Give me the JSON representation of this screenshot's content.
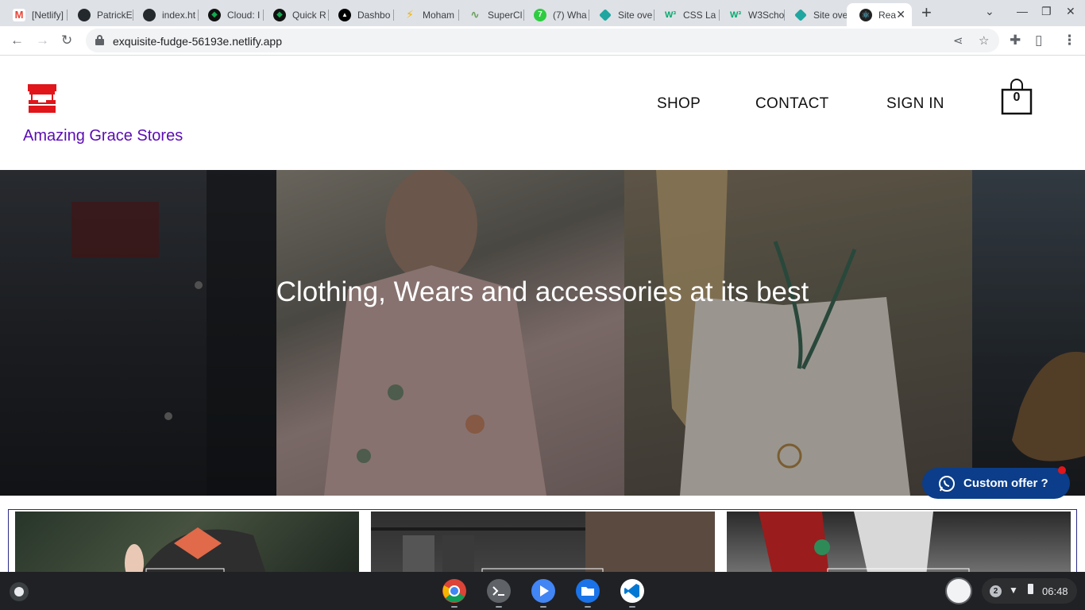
{
  "browser": {
    "tabs": [
      {
        "label": "[Netlify]",
        "icon": "gmail-icon",
        "color": "#ea4335"
      },
      {
        "label": "PatrickE",
        "icon": "github-icon",
        "color": "#24292e"
      },
      {
        "label": "index.ht",
        "icon": "github-icon",
        "color": "#24292e"
      },
      {
        "label": "Cloud: I",
        "icon": "mongodb-leaf-icon",
        "color": "#13aa52"
      },
      {
        "label": "Quick R",
        "icon": "mongodb-leaf-icon",
        "color": "#13aa52"
      },
      {
        "label": "Dashbo",
        "icon": "vercel-triangle-icon",
        "color": "#000000"
      },
      {
        "label": "Moham",
        "icon": "lightning-icon",
        "color": "#f4b400"
      },
      {
        "label": "SuperCl",
        "icon": "waveform-icon",
        "color": "#6a9f5b"
      },
      {
        "label": "(7) Wha",
        "icon": "quora-icon",
        "color": "#2ecc40"
      },
      {
        "label": "Site ove",
        "icon": "netlify-diamond-icon",
        "color": "#20a6a0"
      },
      {
        "label": "CSS La",
        "icon": "w3schools-icon",
        "color": "#04aa6d"
      },
      {
        "label": "W3Scho",
        "icon": "w3schools-icon",
        "color": "#04aa6d"
      },
      {
        "label": "Site ove",
        "icon": "netlify-diamond-icon",
        "color": "#20a6a0"
      },
      {
        "label": "Rea",
        "icon": "react-icon",
        "color": "#61dafb"
      }
    ],
    "url": "exquisite-fudge-56193e.netlify.app"
  },
  "site": {
    "brand": "Amazing Grace Stores",
    "nav": {
      "shop": "SHOP",
      "contact": "CONTACT",
      "signin": "SIGN IN"
    },
    "cart_count": "0",
    "hero_title": "Clothing, Wears and accessories at its best",
    "whatsapp_label": "Custom offer ?"
  },
  "colors": {
    "brand": "#5b0cb3",
    "logo_red": "#e0161b",
    "whatsapp_button": "#0b3d8a"
  },
  "shelf": {
    "apps": [
      "chrome-icon",
      "terminal-icon",
      "play-icon",
      "files-icon",
      "vscode-icon"
    ],
    "notification_count": "2",
    "time": "06:48"
  }
}
